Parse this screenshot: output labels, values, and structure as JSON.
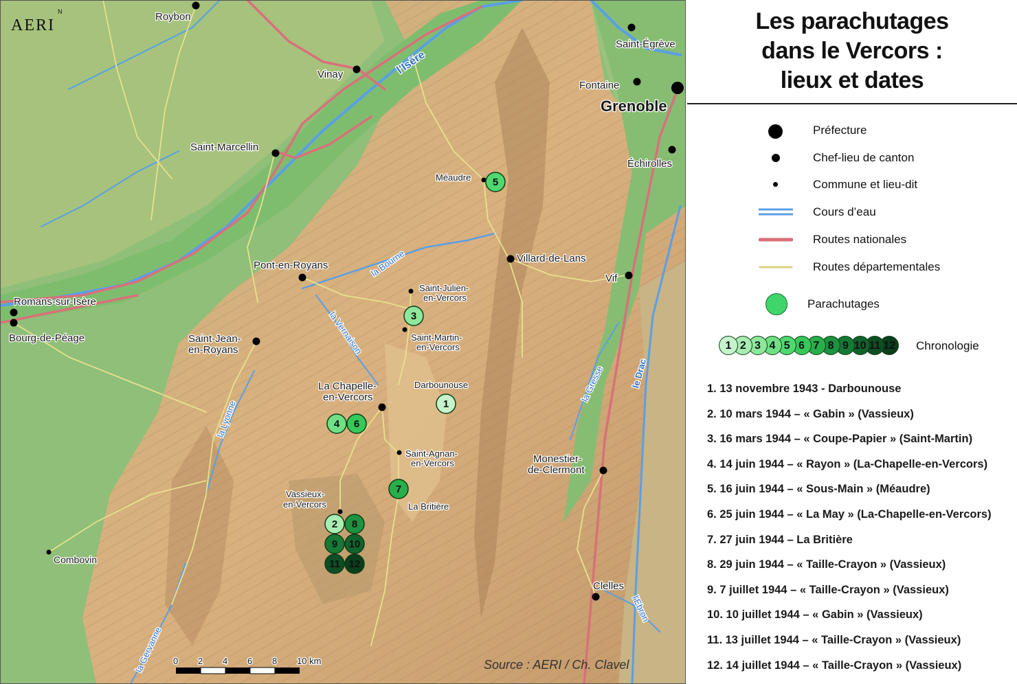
{
  "title": {
    "line1": "Les parachutages",
    "line2": "dans le Vercors :",
    "line3": "lieux et dates"
  },
  "logo": {
    "text": "AERI",
    "north": "N"
  },
  "source": "Source : AERI / Ch. Clavel",
  "scale": {
    "ticks": [
      "0",
      "2",
      "4",
      "6",
      "8",
      "10 km"
    ]
  },
  "colors": {
    "lowland": "#8fc07a",
    "mountain": "#d8b584",
    "river": "#5a9fe6",
    "national_road": "#d9707a",
    "dept_road": "#e4df8c",
    "drop_marker": "#3ed66b"
  },
  "legend": {
    "prefecture": "Préfecture",
    "canton": "Chef-lieu de canton",
    "commune": "Commune et lieu-dit",
    "river": "Cours d’eau",
    "national": "Routes nationales",
    "departmental": "Routes départementales",
    "drops": "Parachutages",
    "chronology": "Chronologie",
    "chronology_numbers": [
      "1",
      "2",
      "3",
      "4",
      "5",
      "6",
      "7",
      "8",
      "9",
      "10",
      "11",
      "12"
    ]
  },
  "places": [
    {
      "id": "roybon",
      "label": "Roybon"
    },
    {
      "id": "vinay",
      "label": "Vinay"
    },
    {
      "id": "saint-egreve",
      "label": "Saint-Égrève"
    },
    {
      "id": "fontaine",
      "label": "Fontaine"
    },
    {
      "id": "grenoble",
      "label": "Grenoble"
    },
    {
      "id": "saint-marcellin",
      "label": "Saint-Marcellin"
    },
    {
      "id": "echirolles",
      "label": "Échirolles"
    },
    {
      "id": "meaudre",
      "label": "Méaudre"
    },
    {
      "id": "villard-de-lans",
      "label": "Villard-de-Lans"
    },
    {
      "id": "pont-en-royans",
      "label": "Pont-en-Royans"
    },
    {
      "id": "vif",
      "label": "Vif"
    },
    {
      "id": "saint-julien-1",
      "label": "Saint-Julien-"
    },
    {
      "id": "saint-julien-2",
      "label": "en-Vercors"
    },
    {
      "id": "romans",
      "label": "Romans-sur-Isère"
    },
    {
      "id": "bourg-de-peage",
      "label": "Bourg-de-Péage"
    },
    {
      "id": "saint-martin-1",
      "label": "Saint-Martin-"
    },
    {
      "id": "saint-martin-2",
      "label": "en-Vercors"
    },
    {
      "id": "saint-jean-1",
      "label": "Saint-Jean-"
    },
    {
      "id": "saint-jean-2",
      "label": "en-Royans"
    },
    {
      "id": "la-chapelle-1",
      "label": "La Chapelle-"
    },
    {
      "id": "la-chapelle-2",
      "label": "en-Vercors"
    },
    {
      "id": "darbounouse",
      "label": "Darbounouse"
    },
    {
      "id": "saint-agnan-1",
      "label": "Saint-Agnan-"
    },
    {
      "id": "saint-agnan-2",
      "label": "en-Vercors"
    },
    {
      "id": "monestier-1",
      "label": "Monestier-"
    },
    {
      "id": "monestier-2",
      "label": "de-Clermont"
    },
    {
      "id": "vassieux-1",
      "label": "Vassieux-"
    },
    {
      "id": "vassieux-2",
      "label": "en-Vercors"
    },
    {
      "id": "la-britiere",
      "label": "La Britière"
    },
    {
      "id": "combovin",
      "label": "Combovin"
    },
    {
      "id": "clelles",
      "label": "Clelles"
    }
  ],
  "rivers": [
    {
      "id": "isere",
      "label": "l'Isère"
    },
    {
      "id": "bourne",
      "label": "la Bourne"
    },
    {
      "id": "vernaison",
      "label": "la Vernaison"
    },
    {
      "id": "lyonne",
      "label": "la Lyonne"
    },
    {
      "id": "gresse",
      "label": "la Gresse"
    },
    {
      "id": "drac",
      "label": "le Drac"
    },
    {
      "id": "ebron",
      "label": "l'Ebron"
    },
    {
      "id": "gervanne",
      "label": "la Gervanne"
    }
  ],
  "drops": [
    {
      "n": "1",
      "text": "1. 13 novembre 1943 - Darbounouse"
    },
    {
      "n": "2",
      "text": "2. 10 mars 1944 – « Gabin » (Vassieux)"
    },
    {
      "n": "3",
      "text": "3. 16 mars 1944 – « Coupe-Papier » (Saint-Martin)"
    },
    {
      "n": "4",
      "text": "4. 14 juin 1944 – « Rayon » (La-Chapelle-en-Vercors)"
    },
    {
      "n": "5",
      "text": "5. 16 juin 1944 – « Sous-Main » (Méaudre)"
    },
    {
      "n": "6",
      "text": "6. 25 juin 1944 – « La May » (La-Chapelle-en-Vercors)"
    },
    {
      "n": "7",
      "text": "7. 27 juin 1944 – La Britière"
    },
    {
      "n": "8",
      "text": "8. 29 juin 1944 – « Taille-Crayon » (Vassieux)"
    },
    {
      "n": "9",
      "text": "9. 7 juillet 1944 – « Taille-Crayon » (Vassieux)"
    },
    {
      "n": "10",
      "text": "10. 10 juillet 1944 – « Gabin » (Vassieux)"
    },
    {
      "n": "11",
      "text": "11. 13 juillet 1944 – « Taille-Crayon » (Vassieux)"
    },
    {
      "n": "12",
      "text": "12. 14 juillet 1944 – « Taille-Crayon » (Vassieux)"
    }
  ]
}
